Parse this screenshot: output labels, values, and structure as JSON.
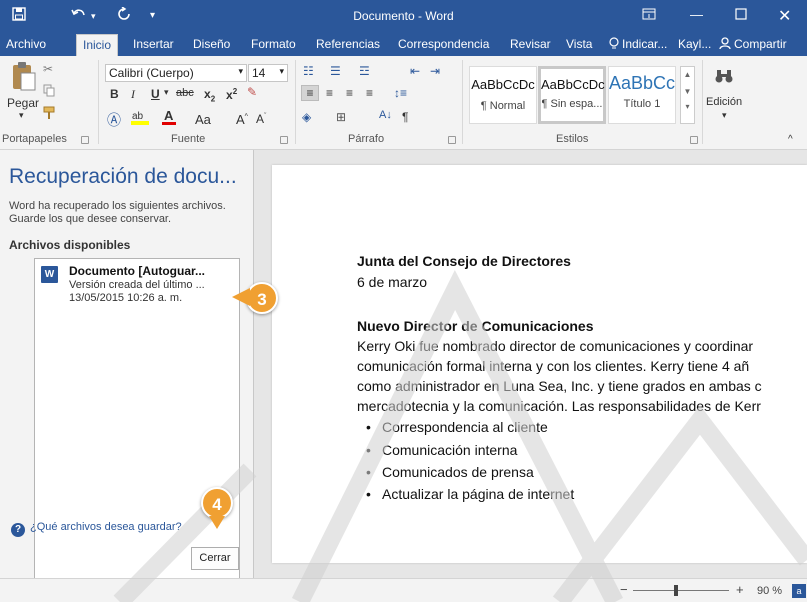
{
  "titlebar": {
    "title": "Documento  -  Word",
    "save_icon": "save-icon",
    "undo_icon": "undo-icon",
    "redo_icon": "redo-icon",
    "customize_icon": "customize-qat-icon",
    "ribbon_display_icon": "ribbon-display-icon",
    "minimize_icon": "minimize-icon",
    "maximize_icon": "maximize-icon",
    "close_icon": "close-icon"
  },
  "tabs": {
    "items": [
      "Archivo",
      "Inicio",
      "Insertar",
      "Diseño",
      "Formato",
      "Referencias",
      "Correspondencia",
      "Revisar",
      "Vista"
    ],
    "active": "Inicio",
    "tellme": "Indicar...",
    "user": "Kayl...",
    "share": "Compartir"
  },
  "ribbon": {
    "clipboard": {
      "paste": "Pegar",
      "label": "Portapapeles"
    },
    "font": {
      "name": "Calibri (Cuerpo)",
      "size": "14",
      "label": "Fuente"
    },
    "paragraph": {
      "label": "Párrafo"
    },
    "styles": {
      "label": "Estilos",
      "items": [
        {
          "preview": "AaBbCcDc",
          "name": "¶ Normal"
        },
        {
          "preview": "AaBbCcDc",
          "name": "¶ Sin espa..."
        },
        {
          "preview": "AaBbCc",
          "name": "Título 1"
        }
      ]
    },
    "editing": {
      "label": "Edición"
    }
  },
  "recovery": {
    "title": "Recuperación de docu...",
    "description": "Word ha recuperado los siguientes archivos. Guarde los que desee conservar.",
    "available_header": "Archivos disponibles",
    "files": [
      {
        "name": "Documento   [Autoguar...",
        "subtitle": "Versión creada del último ...",
        "date": "13/05/2015 10:26 a. m."
      }
    ],
    "help_link": "¿Qué archivos desea guardar?",
    "close_button": "Cerrar"
  },
  "document": {
    "heading": "Junta del Consejo de Directores",
    "date": "6 de marzo",
    "subheading": "Nuevo Director de Comunicaciones",
    "paragraph_lines": [
      "Kerry Oki fue nombrado director de comunicaciones y coordinar",
      "comunicación formal interna y con los clientes. Kerry tiene 4 añ",
      "como administrador en Luna Sea, Inc. y tiene grados en ambas c",
      "mercadotecnia y la comunicación. Las responsabilidades de Kerr"
    ],
    "bullets": [
      "Correspondencia al cliente",
      "Comunicación interna",
      "Comunicados de prensa",
      "Actualizar la página de internet"
    ]
  },
  "callouts": [
    "3",
    "4"
  ],
  "status": {
    "zoom": "90 %",
    "zoom_level": 90
  },
  "colors": {
    "accent": "#2b579a",
    "callout": "#f0a032",
    "watermark": "#bdbdbd"
  }
}
